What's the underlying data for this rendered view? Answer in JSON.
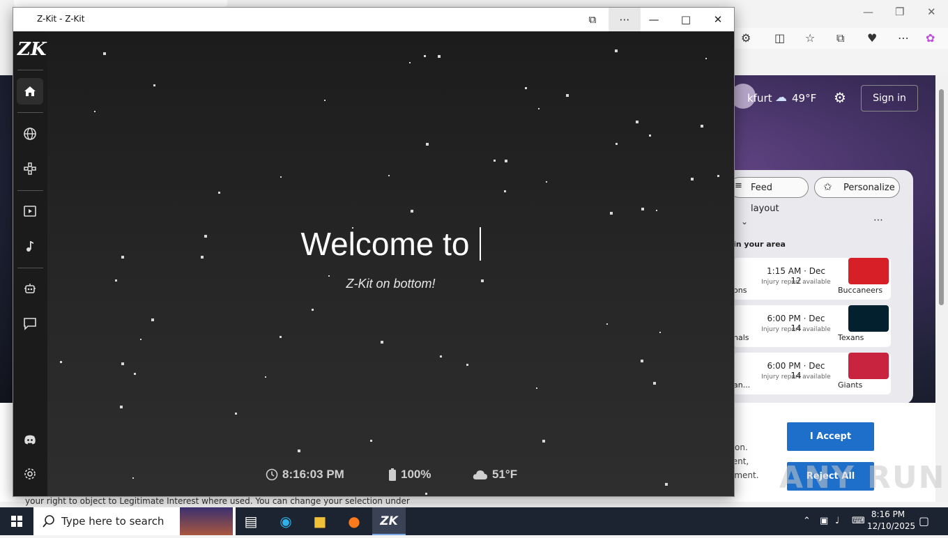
{
  "zkit": {
    "window_title": "Z-Kit - Z-Kit",
    "logo_text": "ZK",
    "welcome_text": "Welcome to",
    "subtitle": "Z-Kit on bottom!",
    "status": {
      "time": "8:16:03 PM",
      "battery": "100%",
      "temperature": "51°F"
    },
    "sidebar_items": [
      "home-icon",
      "globe-icon",
      "gamepad-icon",
      "video-icon",
      "music-icon",
      "robot-icon",
      "chat-icon",
      "discord-icon",
      "settings-icon"
    ]
  },
  "edge": {
    "location_fragment": "kfurt",
    "weather": "49°F",
    "sign_in": "Sign in",
    "feed_layout": "Feed layout",
    "personalize": "Personalize",
    "section_label": "in your area",
    "games": [
      {
        "time": "1:15 AM · Dec 12",
        "note": "Injury report available",
        "left_team": "ons",
        "right_team": "Buccaneers",
        "logo_color": "#d61f26"
      },
      {
        "time": "6:00 PM · Dec 14",
        "note": "Injury report available",
        "left_team": "nals",
        "right_team": "Texans",
        "logo_color": "#03202f"
      },
      {
        "time": "6:00 PM · Dec 14",
        "note": "Injury report available",
        "left_team": "an...",
        "right_team": "Giants",
        "logo_color": "#c9243f"
      }
    ],
    "cookie_lines": [
      "tion.",
      "tent,",
      "oment."
    ],
    "accept_label": "I Accept",
    "reject_label": "Reject All",
    "bottom_text": "your right to object to Legitimate Interest where used. You can change your selection under"
  },
  "watermark": "ANY RUN",
  "taskbar": {
    "search_placeholder": "Type here to search",
    "clock_time": "8:16 PM",
    "clock_date": "12/10/2025"
  }
}
